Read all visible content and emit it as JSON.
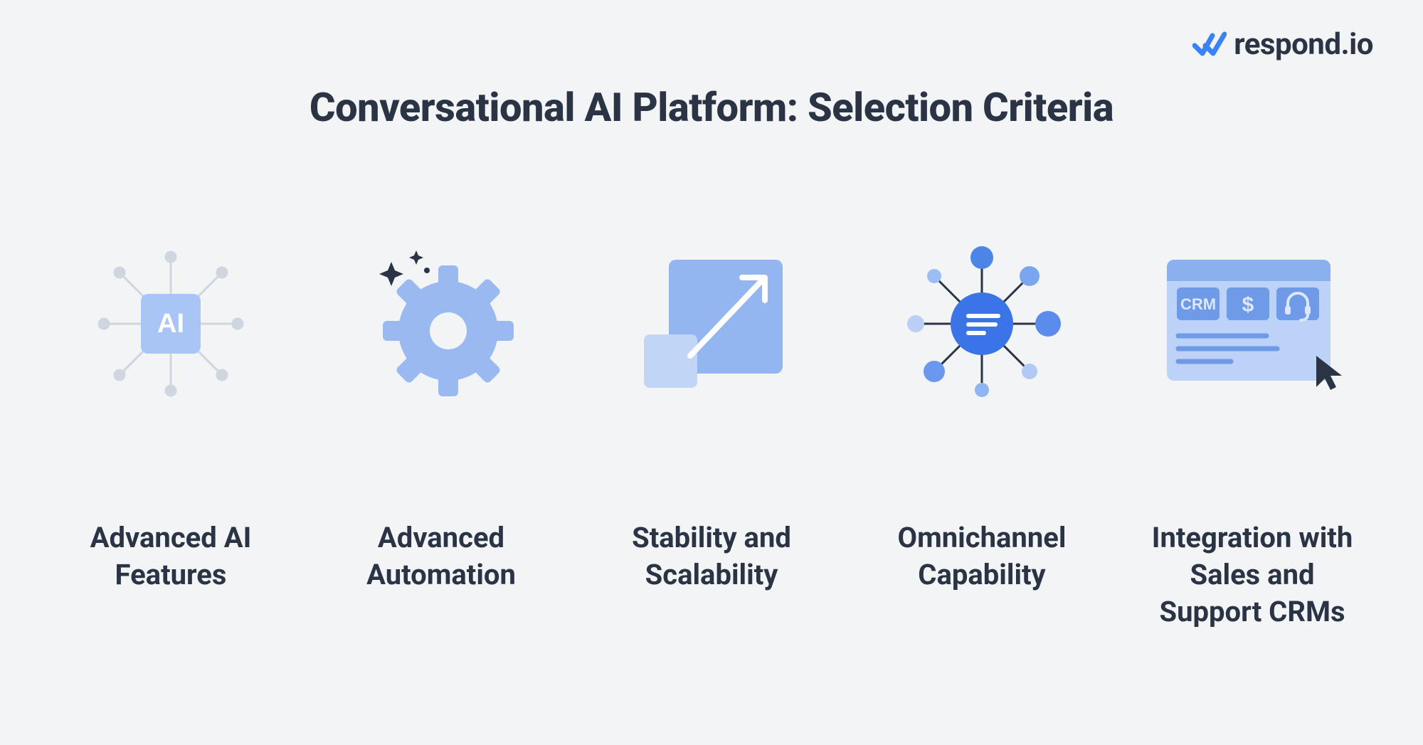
{
  "brand": {
    "name": "respond.io",
    "accent": "#3b82f6",
    "text": "#2a3444"
  },
  "title": "Conversational AI Platform: Selection Criteria",
  "items": [
    {
      "icon": "ai-chip-icon",
      "label": "Advanced AI\nFeatures"
    },
    {
      "icon": "gear-sparkle-icon",
      "label": "Advanced\nAutomation"
    },
    {
      "icon": "scale-arrow-icon",
      "label": "Stability and\nScalability"
    },
    {
      "icon": "omnichannel-hub-icon",
      "label": "Omnichannel\nCapability"
    },
    {
      "icon": "crm-integration-icon",
      "label": "Integration with\nSales and\nSupport CRMs"
    }
  ],
  "crm_card_labels": {
    "crm": "CRM",
    "currency": "$"
  }
}
